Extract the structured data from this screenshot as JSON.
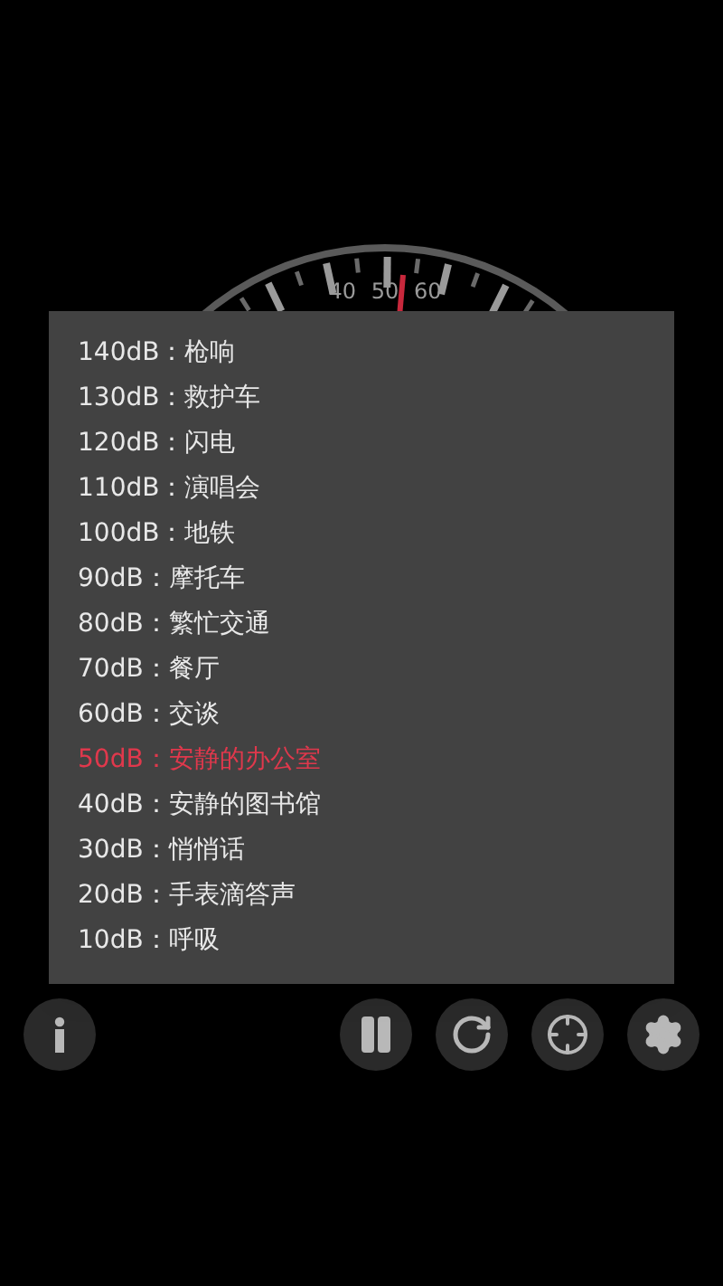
{
  "gauge": {
    "labels": [
      "40",
      "50",
      "60"
    ]
  },
  "dialog": {
    "items": [
      {
        "label": "140dB：枪响",
        "selected": false
      },
      {
        "label": "130dB：救护车",
        "selected": false
      },
      {
        "label": "120dB：闪电",
        "selected": false
      },
      {
        "label": "110dB：演唱会",
        "selected": false
      },
      {
        "label": "100dB：地铁",
        "selected": false
      },
      {
        "label": "90dB：摩托车",
        "selected": false
      },
      {
        "label": "80dB：繁忙交通",
        "selected": false
      },
      {
        "label": "70dB：餐厅",
        "selected": false
      },
      {
        "label": "60dB：交谈",
        "selected": false
      },
      {
        "label": "50dB：安静的办公室",
        "selected": true
      },
      {
        "label": "40dB：安静的图书馆",
        "selected": false
      },
      {
        "label": "30dB：悄悄话",
        "selected": false
      },
      {
        "label": "20dB：手表滴答声",
        "selected": false
      },
      {
        "label": "10dB：呼吸",
        "selected": false
      }
    ]
  },
  "toolbar": {
    "buttons": [
      {
        "kind": "info"
      },
      {
        "kind": "pause"
      },
      {
        "kind": "refresh"
      },
      {
        "kind": "target"
      },
      {
        "kind": "settings"
      }
    ]
  }
}
